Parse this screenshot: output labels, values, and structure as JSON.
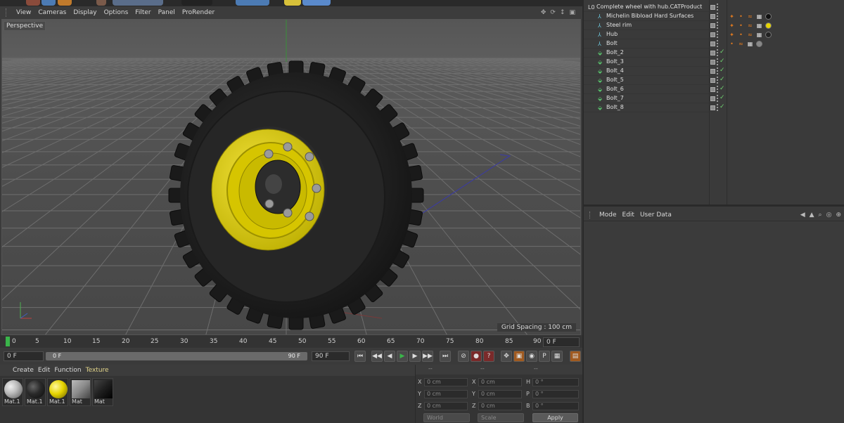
{
  "viewport": {
    "menu": [
      "View",
      "Cameras",
      "Display",
      "Options",
      "Filter",
      "Panel",
      "ProRender"
    ],
    "label": "Perspective",
    "grid_spacing": "Grid Spacing : 100 cm"
  },
  "timeline": {
    "ticks": [
      "0",
      "5",
      "10",
      "15",
      "20",
      "25",
      "30",
      "35",
      "40",
      "45",
      "50",
      "55",
      "60",
      "65",
      "70",
      "75",
      "80",
      "85",
      "90"
    ],
    "current_frame": "0 F",
    "start_frame": "0 F",
    "slider_start": "0 F",
    "slider_end": "90 F",
    "end_frame": "90 F"
  },
  "materials": {
    "menu": [
      "Create",
      "Edit",
      "Function",
      "Texture"
    ],
    "items": [
      {
        "label": "Mat.1",
        "color": "#bcbcbc"
      },
      {
        "label": "Mat.1",
        "color": "#2a2a2a"
      },
      {
        "label": "Mat.1",
        "color": "#e6d400"
      },
      {
        "label": "Mat",
        "color": "#8a8a8a"
      },
      {
        "label": "Mat",
        "color": "#1e1e1e"
      }
    ]
  },
  "coordinates": {
    "header": [
      "--",
      "--",
      "--"
    ],
    "rows": [
      {
        "a1": "X",
        "v1": "0 cm",
        "a2": "X",
        "v2": "0 cm",
        "a3": "H",
        "v3": "0 °"
      },
      {
        "a1": "Y",
        "v1": "0 cm",
        "a2": "Y",
        "v2": "0 cm",
        "a3": "P",
        "v3": "0 °"
      },
      {
        "a1": "Z",
        "v1": "0 cm",
        "a2": "Z",
        "v2": "0 cm",
        "a3": "B",
        "v3": "0 °"
      }
    ],
    "mode_dropdown": "World",
    "type_dropdown": "Scale",
    "apply_label": "Apply"
  },
  "objects": [
    {
      "name": "Complete wheel with hub.CATProduct",
      "indent": 0,
      "icon": "L0"
    },
    {
      "name": "Michelin Bibload Hard Surfaces",
      "indent": 1,
      "icon": "null"
    },
    {
      "name": "Steel rim",
      "indent": 1,
      "icon": "null"
    },
    {
      "name": "Hub",
      "indent": 1,
      "icon": "null"
    },
    {
      "name": "Bolt",
      "indent": 1,
      "icon": "null"
    },
    {
      "name": "Bolt_2",
      "indent": 1,
      "icon": "instance"
    },
    {
      "name": "Bolt_3",
      "indent": 1,
      "icon": "instance"
    },
    {
      "name": "Bolt_4",
      "indent": 1,
      "icon": "instance"
    },
    {
      "name": "Bolt_5",
      "indent": 1,
      "icon": "instance"
    },
    {
      "name": "Bolt_6",
      "indent": 1,
      "icon": "instance"
    },
    {
      "name": "Bolt_7",
      "indent": 1,
      "icon": "instance"
    },
    {
      "name": "Bolt_8",
      "indent": 1,
      "icon": "instance"
    }
  ],
  "attributes": {
    "menu": [
      "Mode",
      "Edit",
      "User Data"
    ]
  },
  "colors": {
    "accent_yellow": "#e6d400",
    "playhead_green": "#3ab54a",
    "check_green": "#6fd16f",
    "instance_green": "#58c06c"
  }
}
